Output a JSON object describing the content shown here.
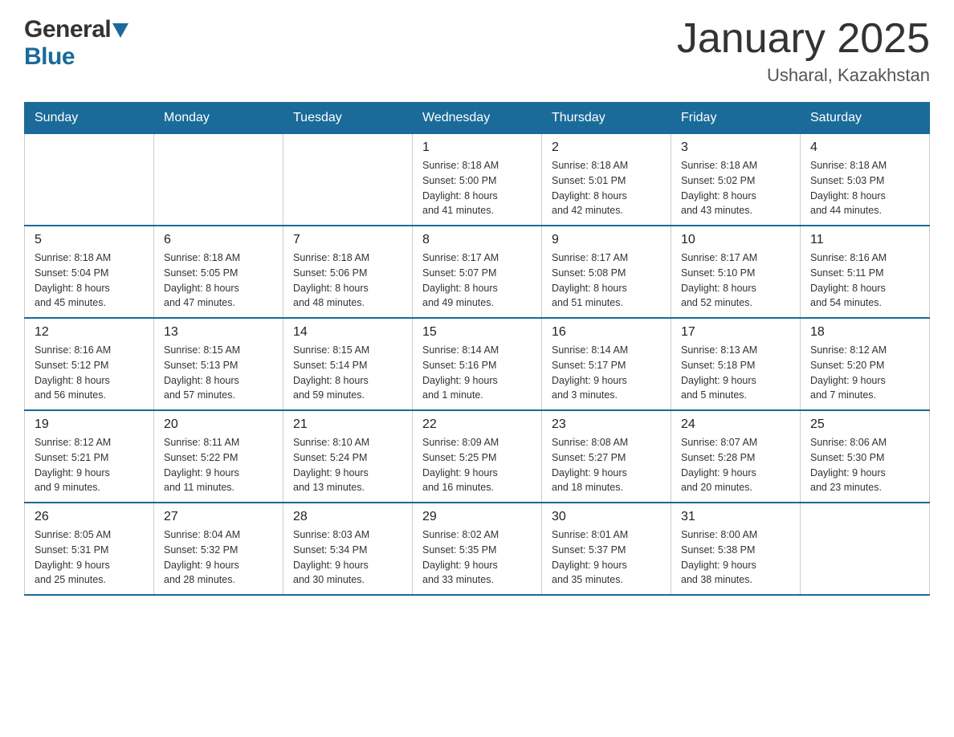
{
  "header": {
    "logo_general": "General",
    "logo_blue": "Blue",
    "title": "January 2025",
    "location": "Usharal, Kazakhstan"
  },
  "days_of_week": [
    "Sunday",
    "Monday",
    "Tuesday",
    "Wednesday",
    "Thursday",
    "Friday",
    "Saturday"
  ],
  "weeks": [
    [
      {
        "day": "",
        "info": ""
      },
      {
        "day": "",
        "info": ""
      },
      {
        "day": "",
        "info": ""
      },
      {
        "day": "1",
        "info": "Sunrise: 8:18 AM\nSunset: 5:00 PM\nDaylight: 8 hours\nand 41 minutes."
      },
      {
        "day": "2",
        "info": "Sunrise: 8:18 AM\nSunset: 5:01 PM\nDaylight: 8 hours\nand 42 minutes."
      },
      {
        "day": "3",
        "info": "Sunrise: 8:18 AM\nSunset: 5:02 PM\nDaylight: 8 hours\nand 43 minutes."
      },
      {
        "day": "4",
        "info": "Sunrise: 8:18 AM\nSunset: 5:03 PM\nDaylight: 8 hours\nand 44 minutes."
      }
    ],
    [
      {
        "day": "5",
        "info": "Sunrise: 8:18 AM\nSunset: 5:04 PM\nDaylight: 8 hours\nand 45 minutes."
      },
      {
        "day": "6",
        "info": "Sunrise: 8:18 AM\nSunset: 5:05 PM\nDaylight: 8 hours\nand 47 minutes."
      },
      {
        "day": "7",
        "info": "Sunrise: 8:18 AM\nSunset: 5:06 PM\nDaylight: 8 hours\nand 48 minutes."
      },
      {
        "day": "8",
        "info": "Sunrise: 8:17 AM\nSunset: 5:07 PM\nDaylight: 8 hours\nand 49 minutes."
      },
      {
        "day": "9",
        "info": "Sunrise: 8:17 AM\nSunset: 5:08 PM\nDaylight: 8 hours\nand 51 minutes."
      },
      {
        "day": "10",
        "info": "Sunrise: 8:17 AM\nSunset: 5:10 PM\nDaylight: 8 hours\nand 52 minutes."
      },
      {
        "day": "11",
        "info": "Sunrise: 8:16 AM\nSunset: 5:11 PM\nDaylight: 8 hours\nand 54 minutes."
      }
    ],
    [
      {
        "day": "12",
        "info": "Sunrise: 8:16 AM\nSunset: 5:12 PM\nDaylight: 8 hours\nand 56 minutes."
      },
      {
        "day": "13",
        "info": "Sunrise: 8:15 AM\nSunset: 5:13 PM\nDaylight: 8 hours\nand 57 minutes."
      },
      {
        "day": "14",
        "info": "Sunrise: 8:15 AM\nSunset: 5:14 PM\nDaylight: 8 hours\nand 59 minutes."
      },
      {
        "day": "15",
        "info": "Sunrise: 8:14 AM\nSunset: 5:16 PM\nDaylight: 9 hours\nand 1 minute."
      },
      {
        "day": "16",
        "info": "Sunrise: 8:14 AM\nSunset: 5:17 PM\nDaylight: 9 hours\nand 3 minutes."
      },
      {
        "day": "17",
        "info": "Sunrise: 8:13 AM\nSunset: 5:18 PM\nDaylight: 9 hours\nand 5 minutes."
      },
      {
        "day": "18",
        "info": "Sunrise: 8:12 AM\nSunset: 5:20 PM\nDaylight: 9 hours\nand 7 minutes."
      }
    ],
    [
      {
        "day": "19",
        "info": "Sunrise: 8:12 AM\nSunset: 5:21 PM\nDaylight: 9 hours\nand 9 minutes."
      },
      {
        "day": "20",
        "info": "Sunrise: 8:11 AM\nSunset: 5:22 PM\nDaylight: 9 hours\nand 11 minutes."
      },
      {
        "day": "21",
        "info": "Sunrise: 8:10 AM\nSunset: 5:24 PM\nDaylight: 9 hours\nand 13 minutes."
      },
      {
        "day": "22",
        "info": "Sunrise: 8:09 AM\nSunset: 5:25 PM\nDaylight: 9 hours\nand 16 minutes."
      },
      {
        "day": "23",
        "info": "Sunrise: 8:08 AM\nSunset: 5:27 PM\nDaylight: 9 hours\nand 18 minutes."
      },
      {
        "day": "24",
        "info": "Sunrise: 8:07 AM\nSunset: 5:28 PM\nDaylight: 9 hours\nand 20 minutes."
      },
      {
        "day": "25",
        "info": "Sunrise: 8:06 AM\nSunset: 5:30 PM\nDaylight: 9 hours\nand 23 minutes."
      }
    ],
    [
      {
        "day": "26",
        "info": "Sunrise: 8:05 AM\nSunset: 5:31 PM\nDaylight: 9 hours\nand 25 minutes."
      },
      {
        "day": "27",
        "info": "Sunrise: 8:04 AM\nSunset: 5:32 PM\nDaylight: 9 hours\nand 28 minutes."
      },
      {
        "day": "28",
        "info": "Sunrise: 8:03 AM\nSunset: 5:34 PM\nDaylight: 9 hours\nand 30 minutes."
      },
      {
        "day": "29",
        "info": "Sunrise: 8:02 AM\nSunset: 5:35 PM\nDaylight: 9 hours\nand 33 minutes."
      },
      {
        "day": "30",
        "info": "Sunrise: 8:01 AM\nSunset: 5:37 PM\nDaylight: 9 hours\nand 35 minutes."
      },
      {
        "day": "31",
        "info": "Sunrise: 8:00 AM\nSunset: 5:38 PM\nDaylight: 9 hours\nand 38 minutes."
      },
      {
        "day": "",
        "info": ""
      }
    ]
  ]
}
